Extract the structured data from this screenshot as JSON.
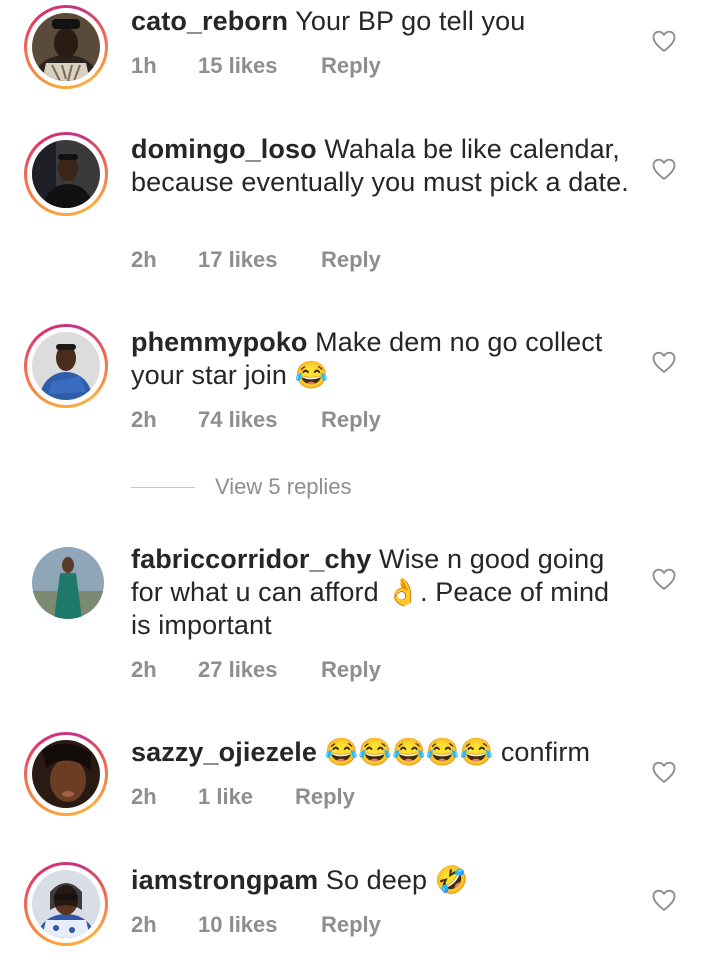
{
  "comments": [
    {
      "username": "cato_reborn",
      "text": "Your BP go tell you",
      "time": "1h",
      "likes": "15 likes",
      "reply": "Reply",
      "ring": true,
      "like_icon": "heart-outline-icon"
    },
    {
      "username": "domingo_loso",
      "text": "Wahala be like calendar, because eventually you must pick a date.",
      "time": "2h",
      "likes": "17 likes",
      "reply": "Reply",
      "ring": true,
      "like_icon": "heart-outline-icon"
    },
    {
      "username": "phemmypoko",
      "text": "Make dem no go collect your star join 😂",
      "time": "2h",
      "likes": "74 likes",
      "reply": "Reply",
      "ring": true,
      "like_icon": "heart-outline-icon"
    },
    {
      "username": "fabriccorridor_chy",
      "text": "Wise n good going for what u can afford 👌. Peace of mind is important",
      "time": "2h",
      "likes": "27 likes",
      "reply": "Reply",
      "ring": false,
      "like_icon": "heart-outline-icon"
    },
    {
      "username": "sazzy_ojiezele",
      "text": "😂😂😂😂😂 confirm",
      "time": "2h",
      "likes": "1 like",
      "reply": "Reply",
      "ring": true,
      "like_icon": "heart-outline-icon"
    },
    {
      "username": "iamstrongpam",
      "text": "So deep 🤣",
      "time": "2h",
      "likes": "10 likes",
      "reply": "Reply",
      "ring": true,
      "like_icon": "heart-outline-icon"
    }
  ],
  "view_replies": "View 5 replies",
  "colors": {
    "text": "#262626",
    "meta": "#8e8e8e",
    "story_ring_start": "#f9a13b",
    "story_ring_end": "#c13584"
  }
}
